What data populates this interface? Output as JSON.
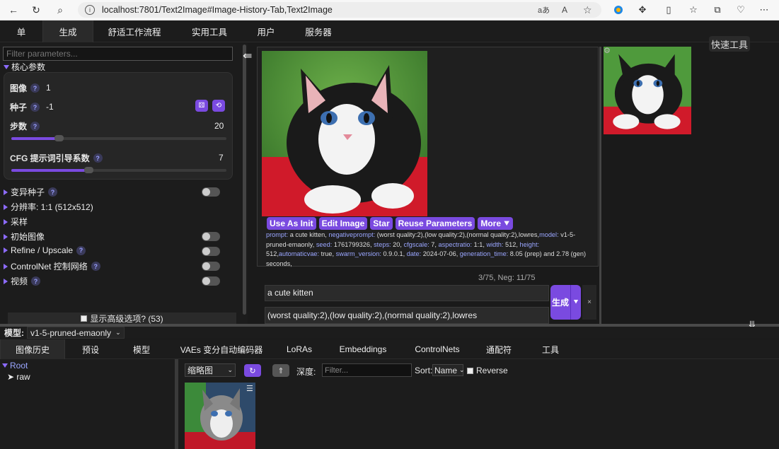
{
  "browser": {
    "url": "localhost:7801/Text2Image#Image-History-Tab,Text2Image",
    "font_icon_label": "aあ",
    "read_aloud_label": "A"
  },
  "top_tabs": [
    {
      "label": "单"
    },
    {
      "label": "生成"
    },
    {
      "label": "舒适工作流程"
    },
    {
      "label": "实用工具"
    },
    {
      "label": "用户"
    },
    {
      "label": "服务器"
    }
  ],
  "left": {
    "filter_placeholder": "Filter parameters...",
    "core_group": "核心参数",
    "params": {
      "images": {
        "label": "图像",
        "value": "1"
      },
      "seed": {
        "label": "种子",
        "value": "-1"
      },
      "steps": {
        "label": "步数",
        "value": "20",
        "fraction": 0.22
      },
      "cfg": {
        "label": "CFG 提示词引导系数",
        "value": "7",
        "fraction": 0.36
      }
    },
    "groups": [
      {
        "label": "变异种子",
        "toggle": true,
        "help": true
      },
      {
        "label": "分辨率: 1:1 (512x512)",
        "toggle": false,
        "help": false
      },
      {
        "label": "采样",
        "toggle": false,
        "help": false
      },
      {
        "label": "初始图像",
        "toggle": true,
        "help": false
      },
      {
        "label": "Refine / Upscale",
        "toggle": true,
        "help": true
      },
      {
        "label": "ControlNet 控制网络",
        "toggle": true,
        "help": true
      },
      {
        "label": "视频",
        "toggle": true,
        "help": true
      }
    ],
    "advanced": "显示高级选项? (53)"
  },
  "image": {
    "buttons": [
      "Use As Init",
      "Edit Image",
      "Star",
      "Reuse Parameters",
      "More ⯆"
    ],
    "meta": [
      {
        "k": "prompt:",
        "v": " a cute kitten, "
      },
      {
        "k": "negativeprompt:",
        "v": " (worst quality:2),(low quality:2),(normal quality:2),lowres,"
      },
      {
        "k": "model:",
        "v": " v1-5-pruned-emaonly, "
      },
      {
        "k": "seed:",
        "v": " 1761799326, "
      },
      {
        "k": "steps:",
        "v": " 20, "
      },
      {
        "k": "cfgscale:",
        "v": " 7, "
      },
      {
        "k": "aspectratio:",
        "v": " 1:1, "
      },
      {
        "k": "width:",
        "v": " 512, "
      },
      {
        "k": "height:",
        "v": " 512,"
      },
      {
        "k": "automaticvae:",
        "v": " true, "
      },
      {
        "k": "swarm_version:",
        "v": " 0.9.0.1, "
      },
      {
        "k": "date:",
        "v": " 2024-07-06, "
      },
      {
        "k": "generation_time:",
        "v": " 8.05 (prep) and 2.78 (gen) seconds,"
      }
    ]
  },
  "prompt": {
    "token_count": "3/75, Neg: 11/75",
    "positive": "a cute kitten",
    "negative": "(worst quality:2),(low quality:2),(normal quality:2),lowres",
    "generate_label": "生成",
    "cancel_label": "×"
  },
  "quick_tools": "快速工具",
  "model_bar": {
    "label": "模型:",
    "value": "v1-5-pruned-emaonly"
  },
  "bottom_tabs": [
    {
      "label": "图像历史"
    },
    {
      "label": "预设"
    },
    {
      "label": "模型"
    },
    {
      "label": "VAEs 变分自动编码器"
    },
    {
      "label": "LoRAs"
    },
    {
      "label": "Embeddings"
    },
    {
      "label": "ControlNets"
    },
    {
      "label": "通配符"
    },
    {
      "label": "工具"
    }
  ],
  "tree": {
    "root": "Root",
    "child": "raw"
  },
  "history": {
    "view_mode": "缩略图",
    "depth_label": "深度:",
    "filter_placeholder": "Filter...",
    "sort_label": "Sort:",
    "sort_value": "Name",
    "reverse_label": "Reverse"
  },
  "colors": {
    "accent": "#7a4ae0",
    "link": "#9aa6ff"
  }
}
